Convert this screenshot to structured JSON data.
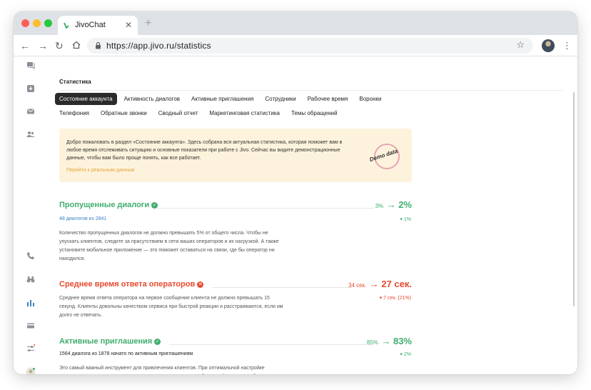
{
  "browser": {
    "tab_title": "JivoChat",
    "tab_close": "✕",
    "new_tab": "+",
    "url": "https://app.jivo.ru/statistics",
    "colors": {
      "traffic_red": "#ff5f57",
      "traffic_yellow": "#febc2e",
      "traffic_green": "#28c840"
    }
  },
  "sidebar": {
    "icons": [
      "chat-bubble-icon",
      "inbox-download-icon",
      "mail-icon",
      "team-icon",
      "phone-icon",
      "binoculars-icon",
      "bar-chart-icon",
      "card-icon",
      "sliders-icon",
      "profile-icon"
    ]
  },
  "page": {
    "title": "Статистика",
    "tabs_row1": [
      "Состояние аккаунта",
      "Активность диалогов",
      "Активные приглашения",
      "Сотрудники",
      "Рабочее время",
      "Воронки"
    ],
    "tabs_row2": [
      "Телефония",
      "Обратные звонки",
      "Сводный отчет",
      "Маркетинговая статистика",
      "Темы обращений"
    ],
    "active_tab": "Состояние аккаунта"
  },
  "banner": {
    "text": "Добро пожаловать в раздел «Состояние аккаунта». Здесь собрана вся актуальная статистика, которая поможет вам в любое время отслеживать ситуацию и основные показатели при работе с Jivo. Сейчас вы видите демонстрационные данные, чтобы вам было проще понять, как все работает.",
    "link": "Перейти к реальным данным",
    "stamp": "Demo data"
  },
  "metrics": [
    {
      "title": "Пропущенные диалоги",
      "status": "ok",
      "old_value": "3%",
      "new_value": "2%",
      "subtitle": "48 диалогов из 2841",
      "delta": "▾ 1%",
      "description": "Количество пропущенных диалогов не должно превышать 5% от общего числа. Чтобы не упускать клиентов, следите за присутствием в сети ваших операторов и их нагрузкой. А также установите мобильное приложение — это поможет оставаться на связи, где бы оператор ни находился."
    },
    {
      "title": "Среднее время ответа операторов",
      "status": "bad",
      "old_value": "34 сек.",
      "new_value": "27 сек.",
      "subtitle": "",
      "delta": "▾ 7 сек. (21%)",
      "description": "Среднее время ответа оператора на первое сообщение клиента не должно превышать 15 секунд. Клиенты довольны качеством сервиса при быстрой реакции и расстраиваются, если им долго не отвечать."
    },
    {
      "title": "Активные приглашения",
      "status": "ok",
      "old_value": "85%",
      "new_value": "83%",
      "subtitle": "1564 диалога из 1878 начато по активным приглашениям",
      "delta": "▾ 2%",
      "description": "Это самый важный инструмент для привлечения клиентов. При оптимальной настройке активные приглашения значительно повышают количество обращений и должны обеспечивать не менее 60% от всех диалогов. Если ваши показатели"
    }
  ],
  "colors": {
    "ok": "#3fae6e",
    "bad": "#e8492d",
    "banner_bg": "#fdf3dc",
    "link": "#e8a43c",
    "active_tab_bg": "#2b2b2b"
  }
}
